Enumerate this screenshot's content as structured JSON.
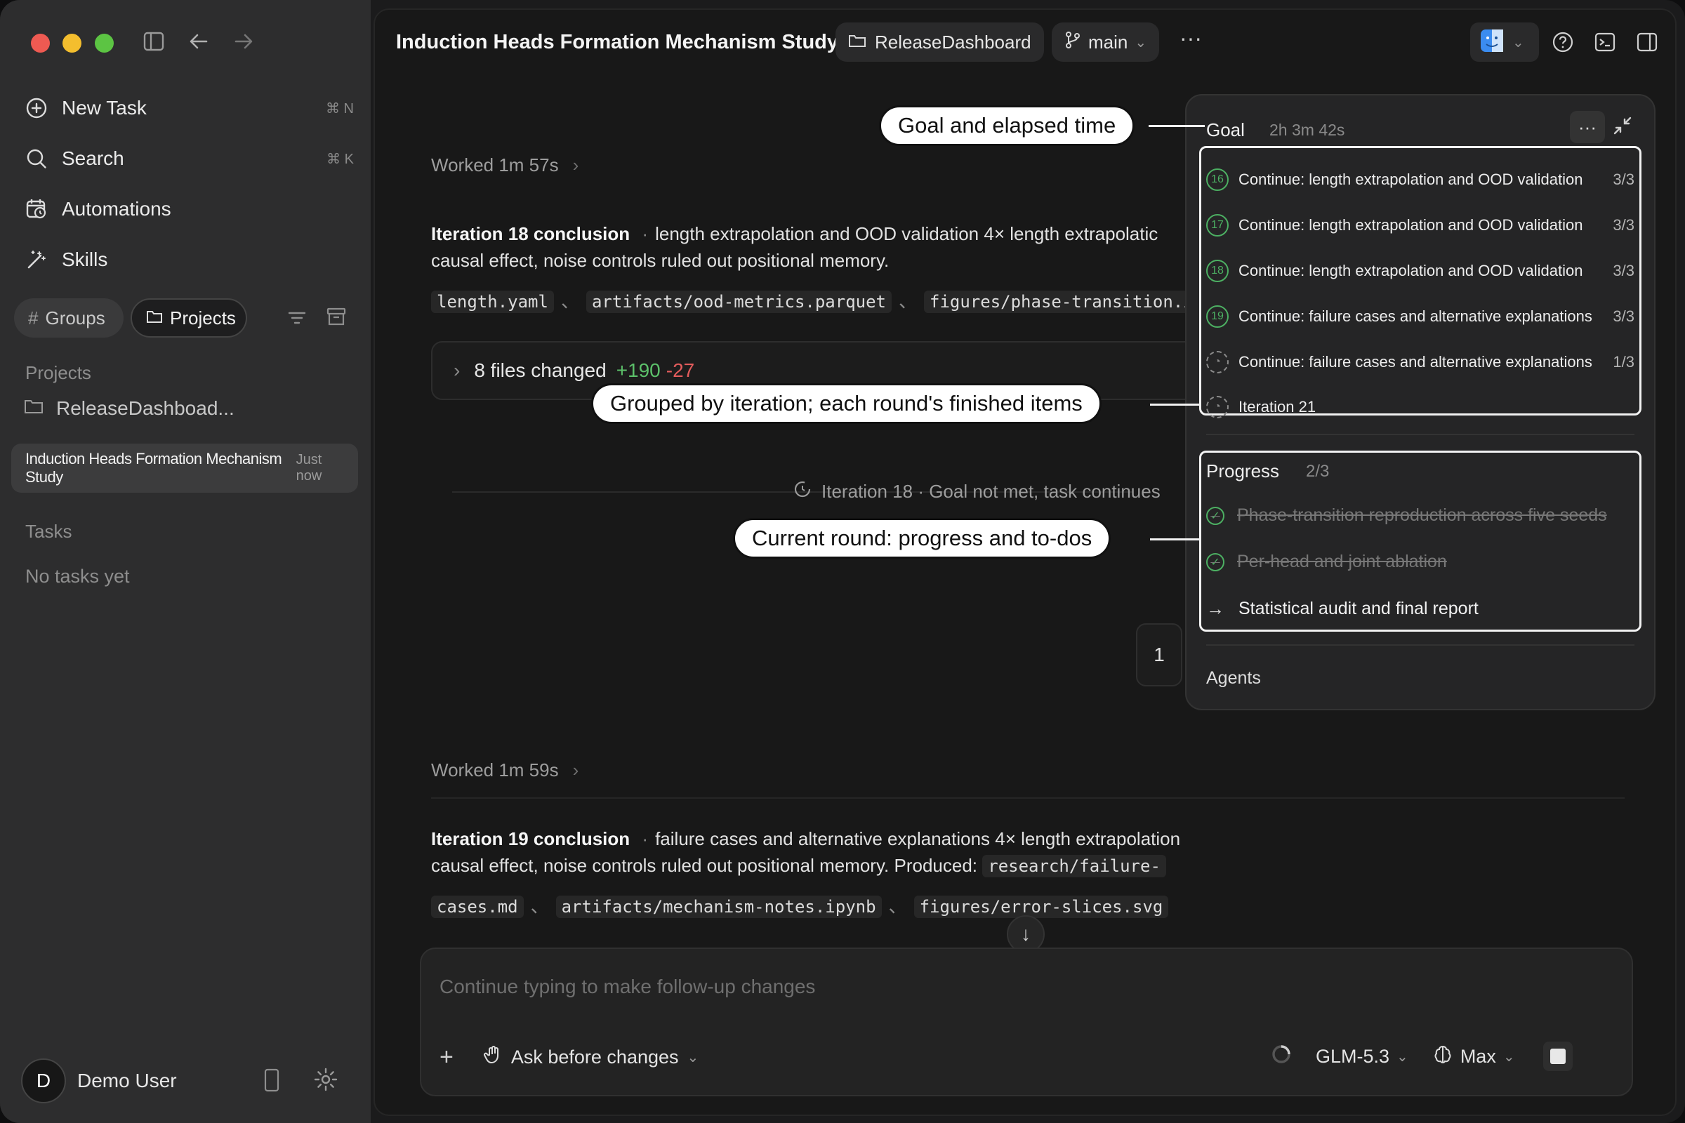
{
  "sidebar": {
    "nav": [
      {
        "label": "New Task",
        "shortcut": "⌘ N"
      },
      {
        "label": "Search",
        "shortcut": "⌘ K"
      },
      {
        "label": "Automations",
        "shortcut": ""
      },
      {
        "label": "Skills",
        "shortcut": ""
      }
    ],
    "groups_label": "Groups",
    "projects_label": "Projects",
    "projects_section": "Projects",
    "project_item": "ReleaseDashboad...",
    "active_task": {
      "title": "Induction Heads Formation Mechanism Study",
      "when": "Just now"
    },
    "tasks_section": "Tasks",
    "no_tasks": "No tasks yet",
    "user": {
      "initial": "D",
      "name": "Demo User"
    }
  },
  "topbar": {
    "title": "Induction Heads Formation Mechanism Study",
    "project_chip": "ReleaseDashboard",
    "branch_chip": "main",
    "more": "···"
  },
  "thread": {
    "worked1": "Worked 1m 57s",
    "iter18_title": "Iteration 18 conclusion",
    "iter18_text1": "length extrapolation and OOD validation 4× length extrapolatic",
    "iter18_text2": "causal effect, noise controls ruled out positional memory.",
    "iter18_files": [
      "length.yaml",
      "artifacts/ood-metrics.parquet",
      "figures/phase-transition.i"
    ],
    "files_changed": "8 files changed",
    "additions": "+190",
    "deletions": "-27",
    "iter_status": "Iteration 18 · Goal not met, task continues",
    "page_num": "1",
    "worked2": "Worked 1m 59s",
    "iter19_title": "Iteration 19 conclusion",
    "iter19_text1": "failure cases and alternative explanations 4× length extrapolation",
    "iter19_text2": "causal effect, noise controls ruled out positional memory. Produced:",
    "iter19_file1": "research/failure-",
    "iter19_files": [
      "cases.md",
      "artifacts/mechanism-notes.ipynb",
      "figures/error-slices.svg"
    ],
    "separator": "、"
  },
  "composer": {
    "placeholder": "Continue typing to make follow-up changes",
    "mode": "Ask before changes",
    "model": "GLM-5.3",
    "effort": "Max"
  },
  "goal_panel": {
    "title": "Goal",
    "elapsed": "2h 3m 42s",
    "rows": [
      {
        "num": "16",
        "label": "Continue: length extrapolation and OOD validation",
        "count": "3/3",
        "done": true
      },
      {
        "num": "17",
        "label": "Continue: length extrapolation and OOD validation",
        "count": "3/3",
        "done": true
      },
      {
        "num": "18",
        "label": "Continue: length extrapolation and OOD validation",
        "count": "3/3",
        "done": true
      },
      {
        "num": "19",
        "label": "Continue: failure cases and alternative explanations",
        "count": "3/3",
        "done": true
      },
      {
        "num": "",
        "label": "Continue: failure cases and alternative explanations",
        "count": "1/3",
        "done": false
      },
      {
        "num": "",
        "label": "Iteration 21",
        "count": "",
        "done": false
      }
    ],
    "progress_title": "Progress",
    "progress_count": "2/3",
    "todos": [
      {
        "label": "Phase-transition reproduction across five seeds",
        "state": "done"
      },
      {
        "label": "Per-head and joint ablation",
        "state": "done"
      },
      {
        "label": "Statistical audit and final report",
        "state": "current"
      }
    ],
    "agents": "Agents"
  },
  "callouts": {
    "goal": "Goal and elapsed time",
    "grouped": "Grouped by iteration; each round's finished items",
    "current": "Current round: progress and to-dos"
  },
  "colors": {
    "accent_green": "#4caf62",
    "deletion_red": "#e35c5c",
    "addition_green": "#5cc06a"
  }
}
